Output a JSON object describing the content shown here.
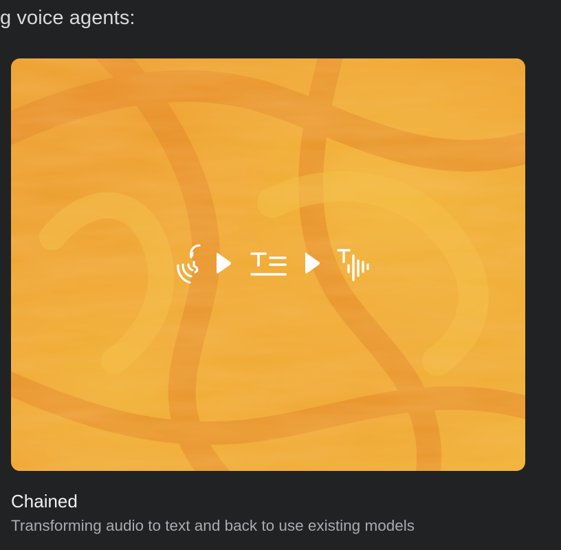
{
  "section": {
    "intro_text": "g voice agents:"
  },
  "card": {
    "title": "Chained",
    "description": "Transforming audio to text and back to use existing models",
    "background": {
      "colors": [
        "#f0b338",
        "#eb9a2e",
        "#e8882a"
      ]
    },
    "flow_icons": [
      "speech-input-icon",
      "play-arrow-icon",
      "text-lines-icon",
      "play-arrow-icon",
      "text-to-speech-icon"
    ],
    "icon_color": "#ffffff"
  }
}
